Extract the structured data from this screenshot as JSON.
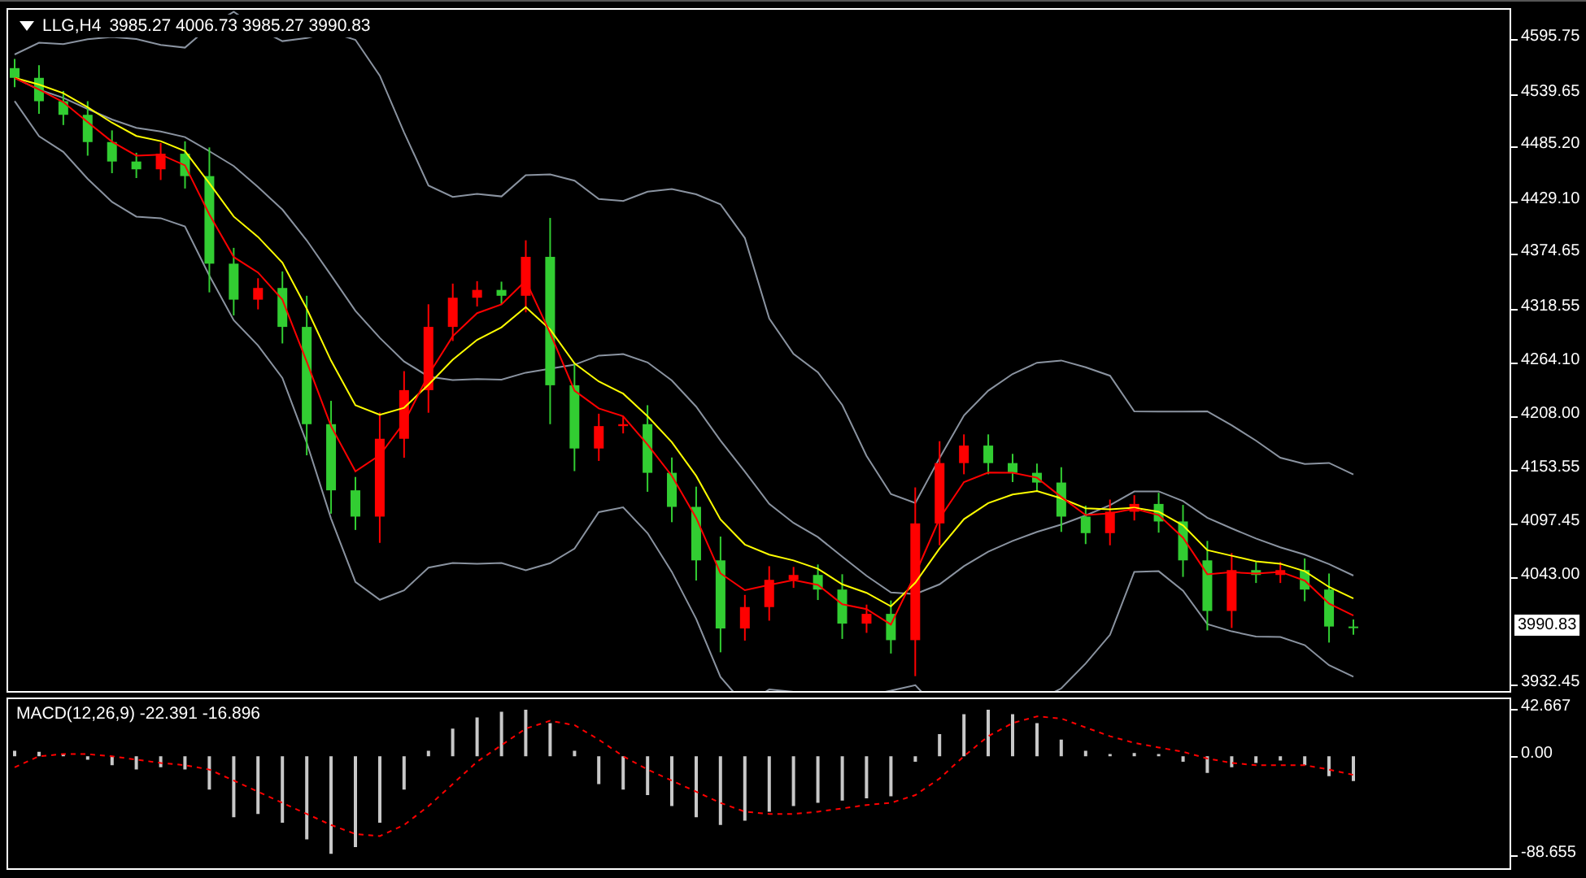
{
  "header": {
    "symbol": "LLG,H4",
    "quote": "3985.27 4006.73 3985.27 3990.83"
  },
  "price_chart": {
    "axis_labels": [
      "4595.75",
      "4539.65",
      "4485.20",
      "4429.10",
      "4374.65",
      "4318.55",
      "4264.10",
      "4208.00",
      "4153.55",
      "4097.45",
      "4043.00",
      "3932.45"
    ],
    "current_price": "3990.83"
  },
  "macd": {
    "title": "MACD(12,26,9) -22.391 -16.896",
    "axis_labels": [
      "42.667",
      "0.00",
      "-88.655"
    ]
  }
}
